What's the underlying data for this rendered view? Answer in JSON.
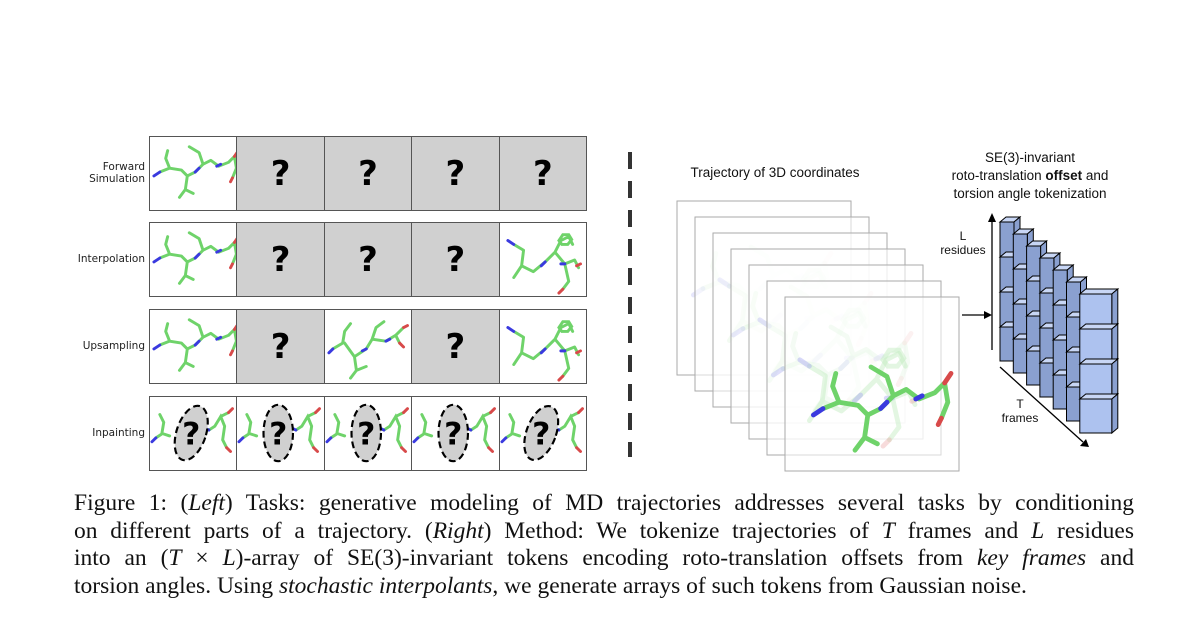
{
  "left_panel": {
    "rows": [
      {
        "label_lines": [
          "Forward",
          "Simulation"
        ],
        "task": "forward-simulation",
        "cells": [
          "structure",
          "masked",
          "masked",
          "masked",
          "masked"
        ]
      },
      {
        "label_lines": [
          "Interpolation"
        ],
        "task": "interpolation",
        "cells": [
          "structure",
          "masked",
          "masked",
          "masked",
          "structure-b"
        ]
      },
      {
        "label_lines": [
          "Upsampling"
        ],
        "task": "upsampling",
        "cells": [
          "structure",
          "masked",
          "structure-c",
          "masked",
          "structure-b"
        ]
      },
      {
        "label_lines": [
          "Inpainting"
        ],
        "task": "inpainting",
        "cells": [
          "inpaint",
          "inpaint",
          "inpaint",
          "inpaint",
          "inpaint"
        ]
      }
    ],
    "mask_symbol": "?"
  },
  "right_panel": {
    "trajectory_title": "Trajectory of 3D coordinates",
    "token_title_lines": [
      "SE(3)-invariant",
      "roto-translation ",
      "offset",
      " and",
      "torsion angle tokenization"
    ],
    "residues_axis": {
      "symbol": "L",
      "label": "residues"
    },
    "frames_axis": {
      "symbol": "T",
      "label": "frames"
    },
    "trajectory_frame_count": 7,
    "token_grid": {
      "frames": 7,
      "residues": 4
    }
  },
  "colors": {
    "carbon": "#6fd36a",
    "nitrogen": "#3a3adf",
    "oxygen": "#d84a4a",
    "mask_gray": "#d0d0d0",
    "cube_front": "#adc2ef",
    "cube_top": "#c8d6f5",
    "cube_side": "#8aa0d0"
  },
  "caption": {
    "lines": [
      [
        {
          "t": "Figure 1: ("
        },
        {
          "t": "Left",
          "i": true
        },
        {
          "t": ") Tasks: generative modeling of MD trajectories addresses several tasks by conditioning"
        }
      ],
      [
        {
          "t": "on different parts of a trajectory. ("
        },
        {
          "t": "Right",
          "i": true
        },
        {
          "t": ") Method: We tokenize trajectories of "
        },
        {
          "t": "T",
          "i": true
        },
        {
          "t": " frames and "
        },
        {
          "t": "L",
          "i": true
        },
        {
          "t": " residues"
        }
      ],
      [
        {
          "t": "into an ("
        },
        {
          "t": "T",
          "i": true
        },
        {
          "t": " × "
        },
        {
          "t": "L",
          "i": true
        },
        {
          "t": ")-array of SE(3)-invariant tokens encoding roto-translation offsets from "
        },
        {
          "t": "key frames",
          "i": true
        },
        {
          "t": " and"
        }
      ],
      [
        {
          "t": "torsion angles. Using "
        },
        {
          "t": "stochastic interpolants",
          "i": true
        },
        {
          "t": ", we generate arrays of such tokens from Gaussian noise."
        }
      ]
    ]
  }
}
